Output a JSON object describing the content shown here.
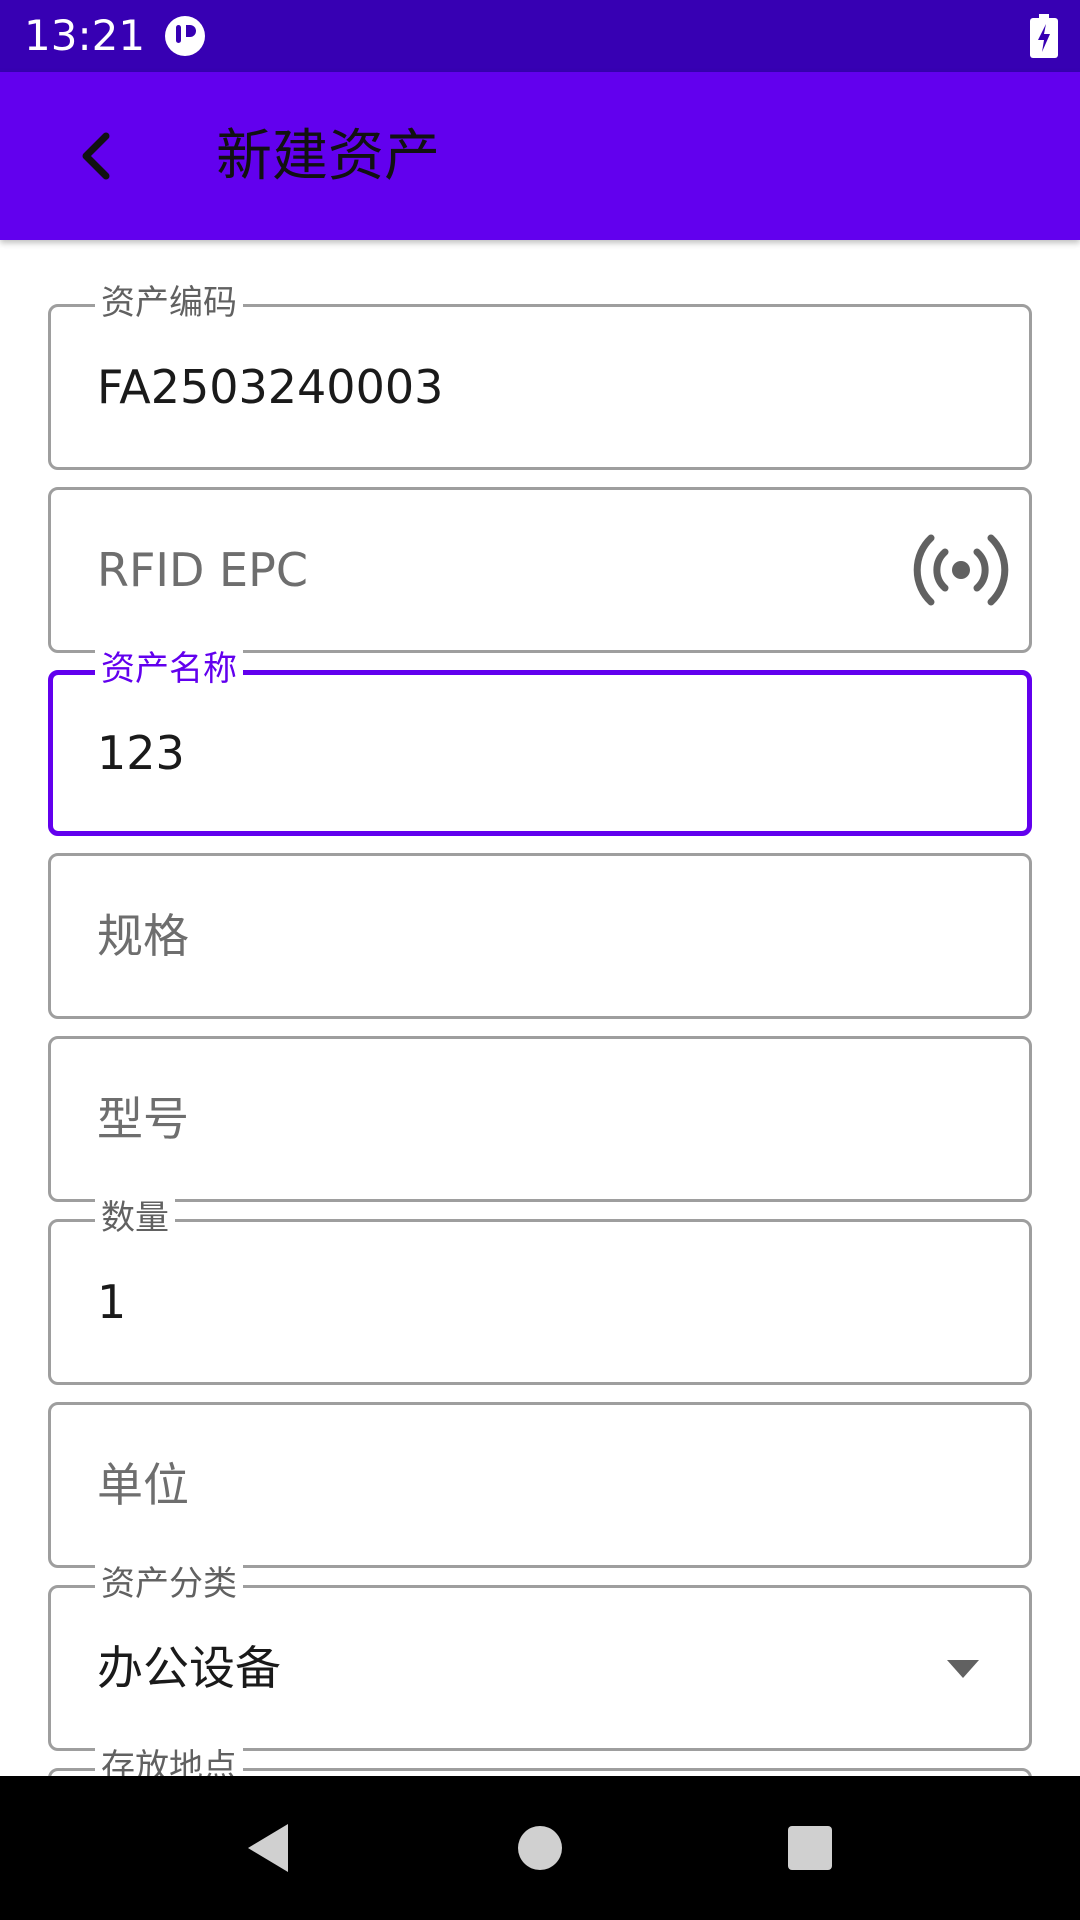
{
  "status_bar": {
    "time": "13:21",
    "app_icon": "app-notification-icon",
    "battery_icon": "battery-charging-icon"
  },
  "app_bar": {
    "title": "新建资产",
    "back_icon": "back-arrow-icon",
    "color": "#6200EE"
  },
  "form": {
    "asset_code": {
      "label": "资产编码",
      "value": "FA2503240003"
    },
    "rfid_epc": {
      "placeholder": "RFID EPC",
      "icon": "rfid-scan-icon"
    },
    "asset_name": {
      "label": "资产名称",
      "value": "123"
    },
    "spec": {
      "placeholder": "规格"
    },
    "model": {
      "placeholder": "型号"
    },
    "quantity": {
      "label": "数量",
      "value": "1"
    },
    "unit": {
      "placeholder": "单位"
    },
    "category": {
      "label": "资产分类",
      "value": "办公设备",
      "icon": "dropdown-arrow-icon"
    },
    "location": {
      "label": "存放地点"
    }
  },
  "nav_bar": {
    "back": "nav-back-icon",
    "home": "nav-home-icon",
    "recents": "nav-recents-icon"
  },
  "colors": {
    "primary": "#6200EE",
    "primary_dark": "#3700B3",
    "outline": "#9e9e9e"
  }
}
